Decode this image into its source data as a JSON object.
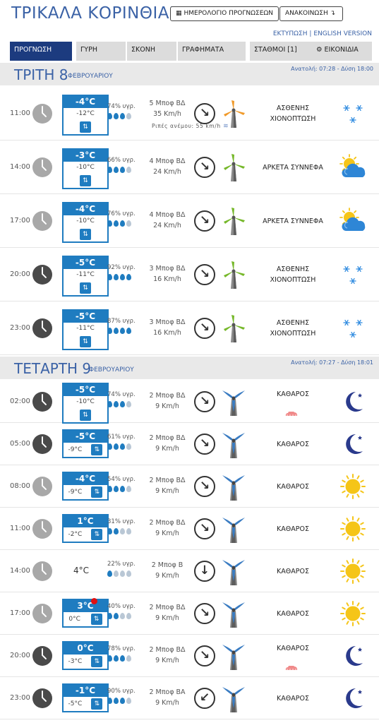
{
  "header": {
    "title": "ΤΡΙΚΑΛΑ ΚΟΡΙΝΘΙΑΣ",
    "calendar_button": "ΗΜΕΡΟΛΟΓΙΟ ΠΡΟΓΝΩΣΕΩΝ",
    "calendar_icon": "calendar-icon",
    "announce_button": "ΑΝΑΚΟΙΝΩΣΗ",
    "announce_icon": "arrow-icon",
    "print_link": "ΕΚΤΥΠΩΣΗ",
    "separator": "|",
    "english_link": "ENGLISH VERSION"
  },
  "tabs": [
    {
      "label": "ΠΡΟΓΝΩΣΗ",
      "active": true
    },
    {
      "label": "ΓΥΡΗ"
    },
    {
      "label": "ΣΚΟΝΗ"
    },
    {
      "label": "ΓΡΑΦΗΜΑΤΑ"
    },
    {
      "label": "ΣΤΑΘΜΟΙ [1]"
    },
    {
      "label": "⚙ ΕΙΚΟΝΙΔΙΑ"
    }
  ],
  "days": [
    {
      "name": "ΤΡΙΤΗ 8",
      "month": "ΦΕΒΡΟΥΑΡΙΟΥ",
      "sun": "Ανατολή: 07:28 - Δύση 18:00",
      "rows": [
        {
          "time": "11:00",
          "clock": "day",
          "tmax": "-4°C",
          "tmin": "-12°C",
          "humidity": "74% υγρ.",
          "drops": 3,
          "wind_speed": "5 Μποφ ΒΔ",
          "wind_kmh": "35 Km/h",
          "gust": "Ριπές ανέμου: 55 km/h",
          "arrow": "↘",
          "turbine": "orange",
          "condition": [
            "ΑΣΘΕΝΗΣ",
            "ΧΙΟΝΟΠΤΩΣΗ"
          ],
          "icon": "snow-icon"
        },
        {
          "time": "14:00",
          "clock": "day",
          "tmax": "-3°C",
          "tmin": "-10°C",
          "humidity": "66% υγρ.",
          "drops": 3,
          "wind_speed": "4 Μποφ ΒΔ",
          "wind_kmh": "24 Km/h",
          "arrow": "↘",
          "turbine": "green",
          "condition": [
            "ΑΡΚΕΤΑ ΣΥΝΝΕΦΑ"
          ],
          "icon": "partly-cloudy-icon"
        },
        {
          "time": "17:00",
          "clock": "day",
          "tmax": "-4°C",
          "tmin": "-10°C",
          "humidity": "76% υγρ.",
          "drops": 3,
          "wind_speed": "4 Μποφ ΒΔ",
          "wind_kmh": "24 Km/h",
          "arrow": "↘",
          "turbine": "green",
          "condition": [
            "ΑΡΚΕΤΑ ΣΥΝΝΕΦΑ"
          ],
          "icon": "partly-cloudy-icon"
        },
        {
          "time": "20:00",
          "clock": "night",
          "tmax": "-5°C",
          "tmin": "-11°C",
          "humidity": "92% υγρ.",
          "drops": 4,
          "wind_speed": "3 Μποφ ΒΔ",
          "wind_kmh": "16 Km/h",
          "arrow": "↘",
          "turbine": "green",
          "condition": [
            "ΑΣΘΕΝΗΣ",
            "ΧΙΟΝΟΠΤΩΣΗ"
          ],
          "icon": "snow-icon"
        },
        {
          "time": "23:00",
          "clock": "night",
          "tmax": "-5°C",
          "tmin": "-11°C",
          "humidity": "87% υγρ.",
          "drops": 4,
          "wind_speed": "3 Μποφ ΒΔ",
          "wind_kmh": "16 Km/h",
          "arrow": "↘",
          "turbine": "green",
          "condition": [
            "ΑΣΘΕΝΗΣ",
            "ΧΙΟΝΟΠΤΩΣΗ"
          ],
          "icon": "snow-icon"
        }
      ]
    },
    {
      "name": "ΤΕΤΑΡΤΗ 9",
      "month": "ΦΕΒΡΟΥΑΡΙΟΥ",
      "sun": "Ανατολή: 07:27 - Δύση 18:01",
      "rows": [
        {
          "time": "02:00",
          "clock": "night",
          "tmax": "-5°C",
          "tmin": "-10°C",
          "humidity": "74% υγρ.",
          "drops": 3,
          "wind_speed": "2 Μποφ ΒΔ",
          "wind_kmh": "9 Km/h",
          "arrow": "↘",
          "turbine": "blue",
          "condition": [
            "ΚΑΘΑΡΟΣ"
          ],
          "rain": true,
          "icon": "moon-icon"
        },
        {
          "time": "05:00",
          "clock": "night",
          "tmax": "-5°C",
          "tmin": "-9°C",
          "compact": true,
          "humidity": "61% υγρ.",
          "drops": 3,
          "wind_speed": "2 Μποφ ΒΔ",
          "wind_kmh": "9 Km/h",
          "arrow": "↘",
          "turbine": "blue",
          "condition": [
            "ΚΑΘΑΡΟΣ"
          ],
          "icon": "moon-icon"
        },
        {
          "time": "08:00",
          "clock": "day",
          "tmax": "-4°C",
          "tmin": "-9°C",
          "compact": true,
          "humidity": "54% υγρ.",
          "drops": 3,
          "wind_speed": "2 Μποφ ΒΔ",
          "wind_kmh": "9 Km/h",
          "arrow": "↘",
          "turbine": "blue",
          "condition": [
            "ΚΑΘΑΡΟΣ"
          ],
          "icon": "sun-icon"
        },
        {
          "time": "11:00",
          "clock": "day",
          "tmax": "1°C",
          "tmin": "-2°C",
          "compact": true,
          "humidity": "31% υγρ.",
          "drops": 2,
          "wind_speed": "2 Μποφ ΒΔ",
          "wind_kmh": "9 Km/h",
          "arrow": "↘",
          "turbine": "blue",
          "condition": [
            "ΚΑΘΑΡΟΣ"
          ],
          "icon": "sun-icon"
        },
        {
          "time": "14:00",
          "clock": "day",
          "tplain": "4°C",
          "humidity": "22% υγρ.",
          "drops": 1,
          "wind_speed": "2 Μποφ Β",
          "wind_kmh": "9 Km/h",
          "arrow": "↓",
          "turbine": "blue",
          "condition": [
            "ΚΑΘΑΡΟΣ"
          ],
          "icon": "sun-icon"
        },
        {
          "time": "17:00",
          "clock": "day",
          "tmax": "3°C",
          "tmin": "0°C",
          "compact": true,
          "reddot": true,
          "humidity": "40% υγρ.",
          "drops": 2,
          "wind_speed": "2 Μποφ ΒΔ",
          "wind_kmh": "9 Km/h",
          "arrow": "↘",
          "turbine": "blue",
          "condition": [
            "ΚΑΘΑΡΟΣ"
          ],
          "icon": "sun-icon"
        },
        {
          "time": "20:00",
          "clock": "night",
          "tmax": "0°C",
          "tmin": "-3°C",
          "compact": true,
          "humidity": "78% υγρ.",
          "drops": 3,
          "wind_speed": "2 Μποφ ΒΔ",
          "wind_kmh": "9 Km/h",
          "arrow": "↘",
          "turbine": "blue",
          "condition": [
            "ΚΑΘΑΡΟΣ"
          ],
          "rain": true,
          "icon": "moon-icon"
        },
        {
          "time": "23:00",
          "clock": "night",
          "tmax": "-1°C",
          "tmin": "-5°C",
          "compact": true,
          "humidity": "90% υγρ.",
          "drops": 3,
          "wind_speed": "2 Μποφ ΒΑ",
          "wind_kmh": "9 Km/h",
          "arrow": "↙",
          "turbine": "blue",
          "condition": [
            "ΚΑΘΑΡΟΣ"
          ],
          "icon": "moon-icon"
        }
      ]
    }
  ],
  "colors": {
    "accent": "#3b62a6",
    "tab_active": "#1c3b7f",
    "temp_box": "#1f7cc0",
    "sun": "#f5c518",
    "moon": "#2a3a8c",
    "snow": "#2f8be0"
  }
}
